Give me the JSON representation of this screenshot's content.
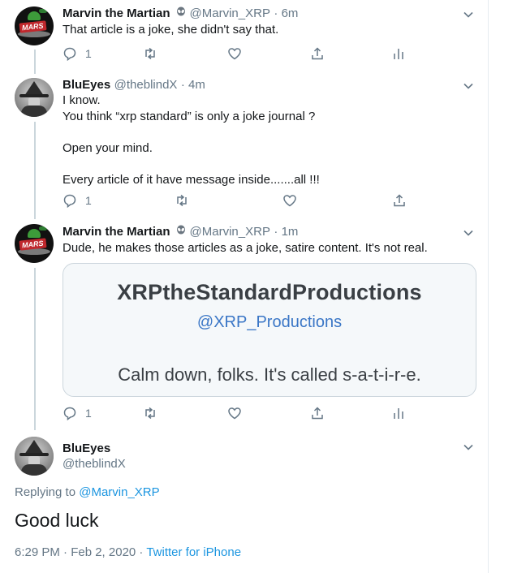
{
  "tweets": [
    {
      "name": "Marvin the Martian",
      "handle": "@Marvin_XRP",
      "time": "· 6m",
      "text": "That article is a joke, she didn't say that.",
      "replies": "1"
    },
    {
      "name": "BluEyes",
      "handle": "@theblindX",
      "time": "· 4m",
      "text": "I know.\nYou think “xrp standard” is only a joke journal ?\n\nOpen your mind.\n\nEvery article of it have message inside.......all !!!",
      "replies": "1"
    },
    {
      "name": "Marvin the Martian",
      "handle": "@Marvin_XRP",
      "time": "· 1m",
      "text": "Dude, he makes those articles as a joke, satire content. It's not real.",
      "replies": "1",
      "card": {
        "title": "XRPtheStandardProductions",
        "handle": "@XRP_Productions",
        "body": "Calm down, folks. It's called s-a-t-i-r-e."
      }
    }
  ],
  "focus": {
    "name": "BluEyes",
    "handle": "@theblindX",
    "replying_label": "Replying to",
    "replying_to": "@Marvin_XRP",
    "text": "Good luck",
    "timestamp": "6:29 PM · Feb 2, 2020 ·",
    "source": "Twitter for iPhone"
  },
  "icons": {
    "reply": "reply-icon",
    "retweet": "retweet-icon",
    "like": "heart-icon",
    "share": "share-icon",
    "analytics": "analytics-icon",
    "more": "chevron-down-icon",
    "badge": "alien-icon"
  },
  "colors": {
    "link": "#1b95e0",
    "muted": "#657786",
    "text": "#14171a",
    "thread_line": "#cbd6dc"
  }
}
